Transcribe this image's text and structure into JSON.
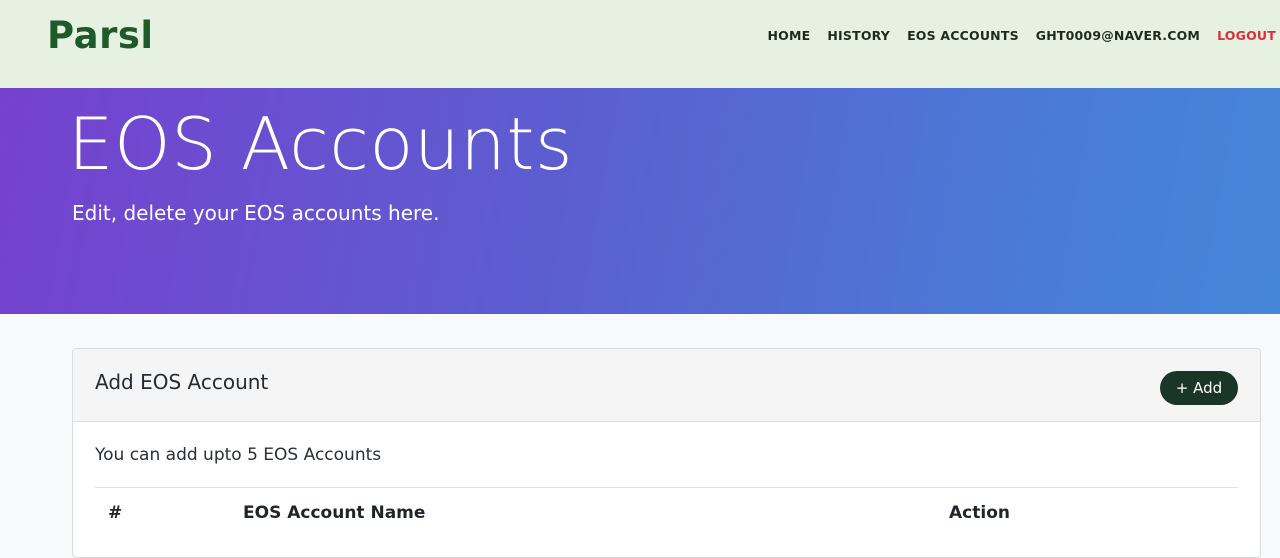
{
  "brand": {
    "logo_text": "Parsl"
  },
  "nav": {
    "items": [
      {
        "label": "HOME"
      },
      {
        "label": "HISTORY"
      },
      {
        "label": "EOS ACCOUNTS"
      },
      {
        "label": "GHT0009@NAVER.COM"
      },
      {
        "label": "LOGOUT"
      }
    ]
  },
  "hero": {
    "title": "EOS Accounts",
    "subtitle": "Edit, delete your EOS accounts here."
  },
  "card": {
    "title": "Add EOS Account",
    "add_button_label": "+ Add",
    "description": "You can add upto 5 EOS Accounts",
    "table_headers": [
      "#",
      "EOS Account Name",
      "Action"
    ]
  },
  "colors": {
    "nav_bg": "#e6f1e2",
    "logo": "#1f5a2a",
    "logout": "#d9303c",
    "hero_gradient_start": "#7641cf",
    "hero_gradient_end": "#4686d8",
    "add_button_bg": "#1b3526"
  }
}
